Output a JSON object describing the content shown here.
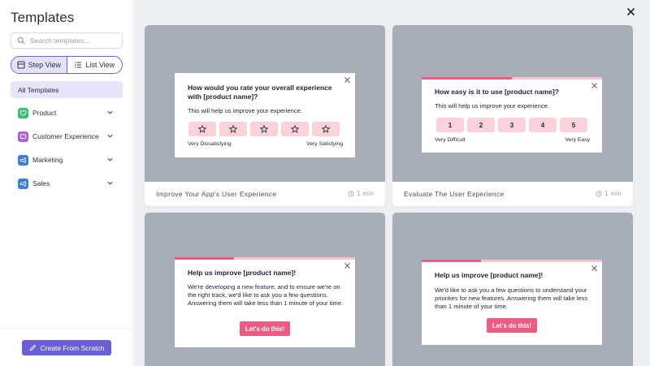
{
  "sidebar": {
    "title": "Templates",
    "search_placeholder": "Search templates...",
    "view_toggle": {
      "step_view": "Step View",
      "list_view": "List View",
      "active": "step_view"
    },
    "all_templates": "All Templates",
    "categories": [
      {
        "label": "Product",
        "icon": "heart-icon",
        "color": "#38c172"
      },
      {
        "label": "Customer Experience",
        "icon": "chat-icon",
        "color": "#b15fd3"
      },
      {
        "label": "Marketing",
        "icon": "megaphone-icon",
        "color": "#3d7fd6"
      },
      {
        "label": "Sales",
        "icon": "megaphone-icon",
        "color": "#3d7fd6"
      }
    ],
    "create_button": "Create From Scratch"
  },
  "colors": {
    "accent": "#6b5fd6",
    "pink": "#ec5b83",
    "pink_light": "#fbd1dc",
    "preview_bg": "#a8aeb8"
  },
  "cards": [
    {
      "name": "Improve Your App's User Experience",
      "time": "1 min",
      "popup": {
        "question": "How would you rate your overall experience with [product name]?",
        "subtitle": "This will help us improve your experience.",
        "options": [
          "star",
          "star",
          "star",
          "star",
          "star"
        ],
        "low_label": "Very Dissatisfying",
        "high_label": "Very Satisfying"
      }
    },
    {
      "name": "Evaluate The User Experience",
      "time": "1 min",
      "popup": {
        "progress": 0.5,
        "question": "How easy is it to use [product name]?",
        "subtitle": "This will help us improve your experience.",
        "options": [
          "1",
          "2",
          "3",
          "4",
          "5"
        ],
        "low_label": "Very Difficult",
        "high_label": "Very Easy"
      }
    },
    {
      "popup": {
        "progress": 0.33,
        "question": "Help us improve [product name]!",
        "body": "We're developing a new feature, and to ensure we're on the right track, we'd like to ask you a few questions. Answering them will take less than 1 minute of your time.",
        "cta": "Let's do this!"
      }
    },
    {
      "popup": {
        "progress": 0.33,
        "question": "Help us improve [product name]!",
        "body": "We'd like to ask you a few questions to understand your priorities for new features. Answering them will take less than 1 minute of your time.",
        "cta": "Let's do this!"
      }
    }
  ]
}
